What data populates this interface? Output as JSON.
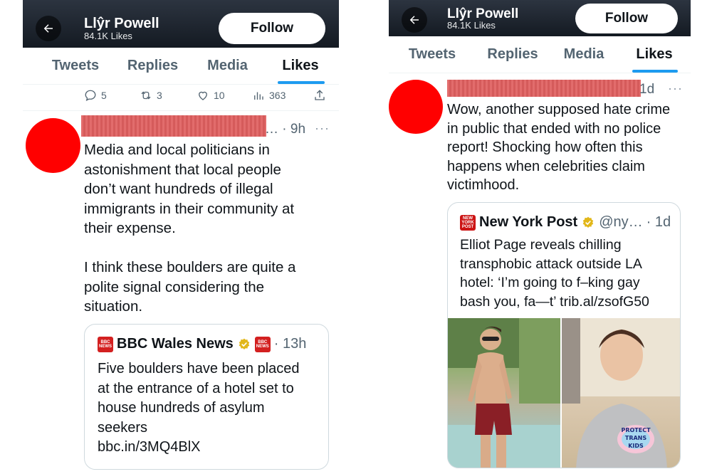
{
  "left": {
    "header": {
      "name": "Llŷr Powell",
      "likes": "84.1K Likes",
      "follow_label": "Follow"
    },
    "tabs": [
      {
        "label": "Tweets",
        "active": false
      },
      {
        "label": "Replies",
        "active": false
      },
      {
        "label": "Media",
        "active": false
      },
      {
        "label": "Likes",
        "active": true
      }
    ],
    "stats": {
      "replies": "5",
      "retweets": "3",
      "likes": "10",
      "views": "363"
    },
    "tweet": {
      "time": "9h",
      "dots": "…",
      "text": "Media and local politicians in\nastonishment that local people\ndon’t want hundreds of illegal\nimmigrants in their community at\ntheir expense.\n\nI think these boulders are quite a\npolite signal considering the\nsituation."
    },
    "quote": {
      "name": "BBC Wales News",
      "time": "13h",
      "text": "Five boulders have been placed\nat the entrance of a hotel set to\nhouse hundreds of asylum\nseekers\nbbc.in/3MQ4BlX",
      "logo": "BBC\nNEWS"
    }
  },
  "right": {
    "header": {
      "name": "Llŷr Powell",
      "likes": "84.1K Likes",
      "follow_label": "Follow"
    },
    "tabs": [
      {
        "label": "Tweets",
        "active": false
      },
      {
        "label": "Replies",
        "active": false
      },
      {
        "label": "Media",
        "active": false
      },
      {
        "label": "Likes",
        "active": true
      }
    ],
    "tweet": {
      "time": "1d",
      "text": "Wow, another supposed hate crime\nin public that ended with no police\nreport! Shocking how often this\nhappens when celebrities claim\nvictimhood."
    },
    "quote": {
      "name": "New York Post",
      "handle": "@ny…",
      "time": "1d",
      "text": "Elliot Page reveals chilling\ntransphobic attack outside LA\nhotel: ‘I’m going to f–king gay\nbash you, fa—t’ trib.al/zsofG50",
      "logo": "NEW\nYORK\nPOST"
    },
    "sweater_text": "PROTECT\nTRANS\nKIDS"
  },
  "colors": {
    "accent": "#1d9bf0",
    "avatar": "#ff0000",
    "verified": "#e2b719",
    "header_bg": "#1b222b"
  }
}
